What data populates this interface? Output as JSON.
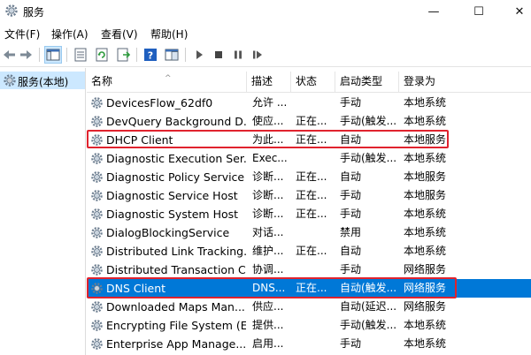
{
  "window": {
    "title": "服务",
    "minimize": "—",
    "maximize": "☐",
    "close": "✕"
  },
  "menu": [
    {
      "label": "文件(F)"
    },
    {
      "label": "操作(A)"
    },
    {
      "label": "查看(V)"
    },
    {
      "label": "帮助(H)"
    }
  ],
  "toolbar": {
    "icons": [
      "back-arrow-icon",
      "forward-arrow-icon",
      "console-tree-icon",
      "properties-icon",
      "refresh-icon",
      "export-list-icon",
      "help-icon",
      "console-view-icon",
      "start-service-icon",
      "stop-service-icon",
      "pause-service-icon",
      "restart-service-icon"
    ]
  },
  "tree": {
    "label": "服务(本地)"
  },
  "columns": [
    "名称",
    "描述",
    "状态",
    "启动类型",
    "登录为"
  ],
  "rows": [
    {
      "name": "DevicesFlow_62df0",
      "desc": "允许 ...",
      "status": "",
      "start": "手动",
      "logon": "本地系统"
    },
    {
      "name": "DevQuery Background D...",
      "desc": "使应...",
      "status": "正在...",
      "start": "手动(触发...",
      "logon": "本地系统"
    },
    {
      "name": "DHCP Client",
      "desc": "为此...",
      "status": "正在...",
      "start": "自动",
      "logon": "本地服务"
    },
    {
      "name": "Diagnostic Execution Ser...",
      "desc": "Exec...",
      "status": "",
      "start": "手动(触发...",
      "logon": "本地系统"
    },
    {
      "name": "Diagnostic Policy Service",
      "desc": "诊断...",
      "status": "正在...",
      "start": "自动",
      "logon": "本地服务"
    },
    {
      "name": "Diagnostic Service Host",
      "desc": "诊断...",
      "status": "正在...",
      "start": "手动",
      "logon": "本地服务"
    },
    {
      "name": "Diagnostic System Host",
      "desc": "诊断...",
      "status": "正在...",
      "start": "手动",
      "logon": "本地系统"
    },
    {
      "name": "DialogBlockingService",
      "desc": "对话...",
      "status": "",
      "start": "禁用",
      "logon": "本地系统"
    },
    {
      "name": "Distributed Link Tracking...",
      "desc": "维护...",
      "status": "正在...",
      "start": "自动",
      "logon": "本地系统"
    },
    {
      "name": "Distributed Transaction C...",
      "desc": "协调...",
      "status": "",
      "start": "手动",
      "logon": "网络服务"
    },
    {
      "name": "DNS Client",
      "desc": "DNS...",
      "status": "正在...",
      "start": "自动(触发...",
      "logon": "网络服务"
    },
    {
      "name": "Downloaded Maps Man...",
      "desc": "供应...",
      "status": "",
      "start": "自动(延迟...",
      "logon": "网络服务"
    },
    {
      "name": "Encrypting File System (E...",
      "desc": "提供...",
      "status": "",
      "start": "手动(触发...",
      "logon": "本地系统"
    },
    {
      "name": "Enterprise App Manage...",
      "desc": "启用...",
      "status": "",
      "start": "手动",
      "logon": "本地系统"
    }
  ],
  "selected_row": 10,
  "highlighted_rows": [
    2,
    10
  ],
  "colors": {
    "selection": "#0078d7",
    "highlight_border": "#e0232e",
    "tree_selection": "#cce8ff"
  }
}
